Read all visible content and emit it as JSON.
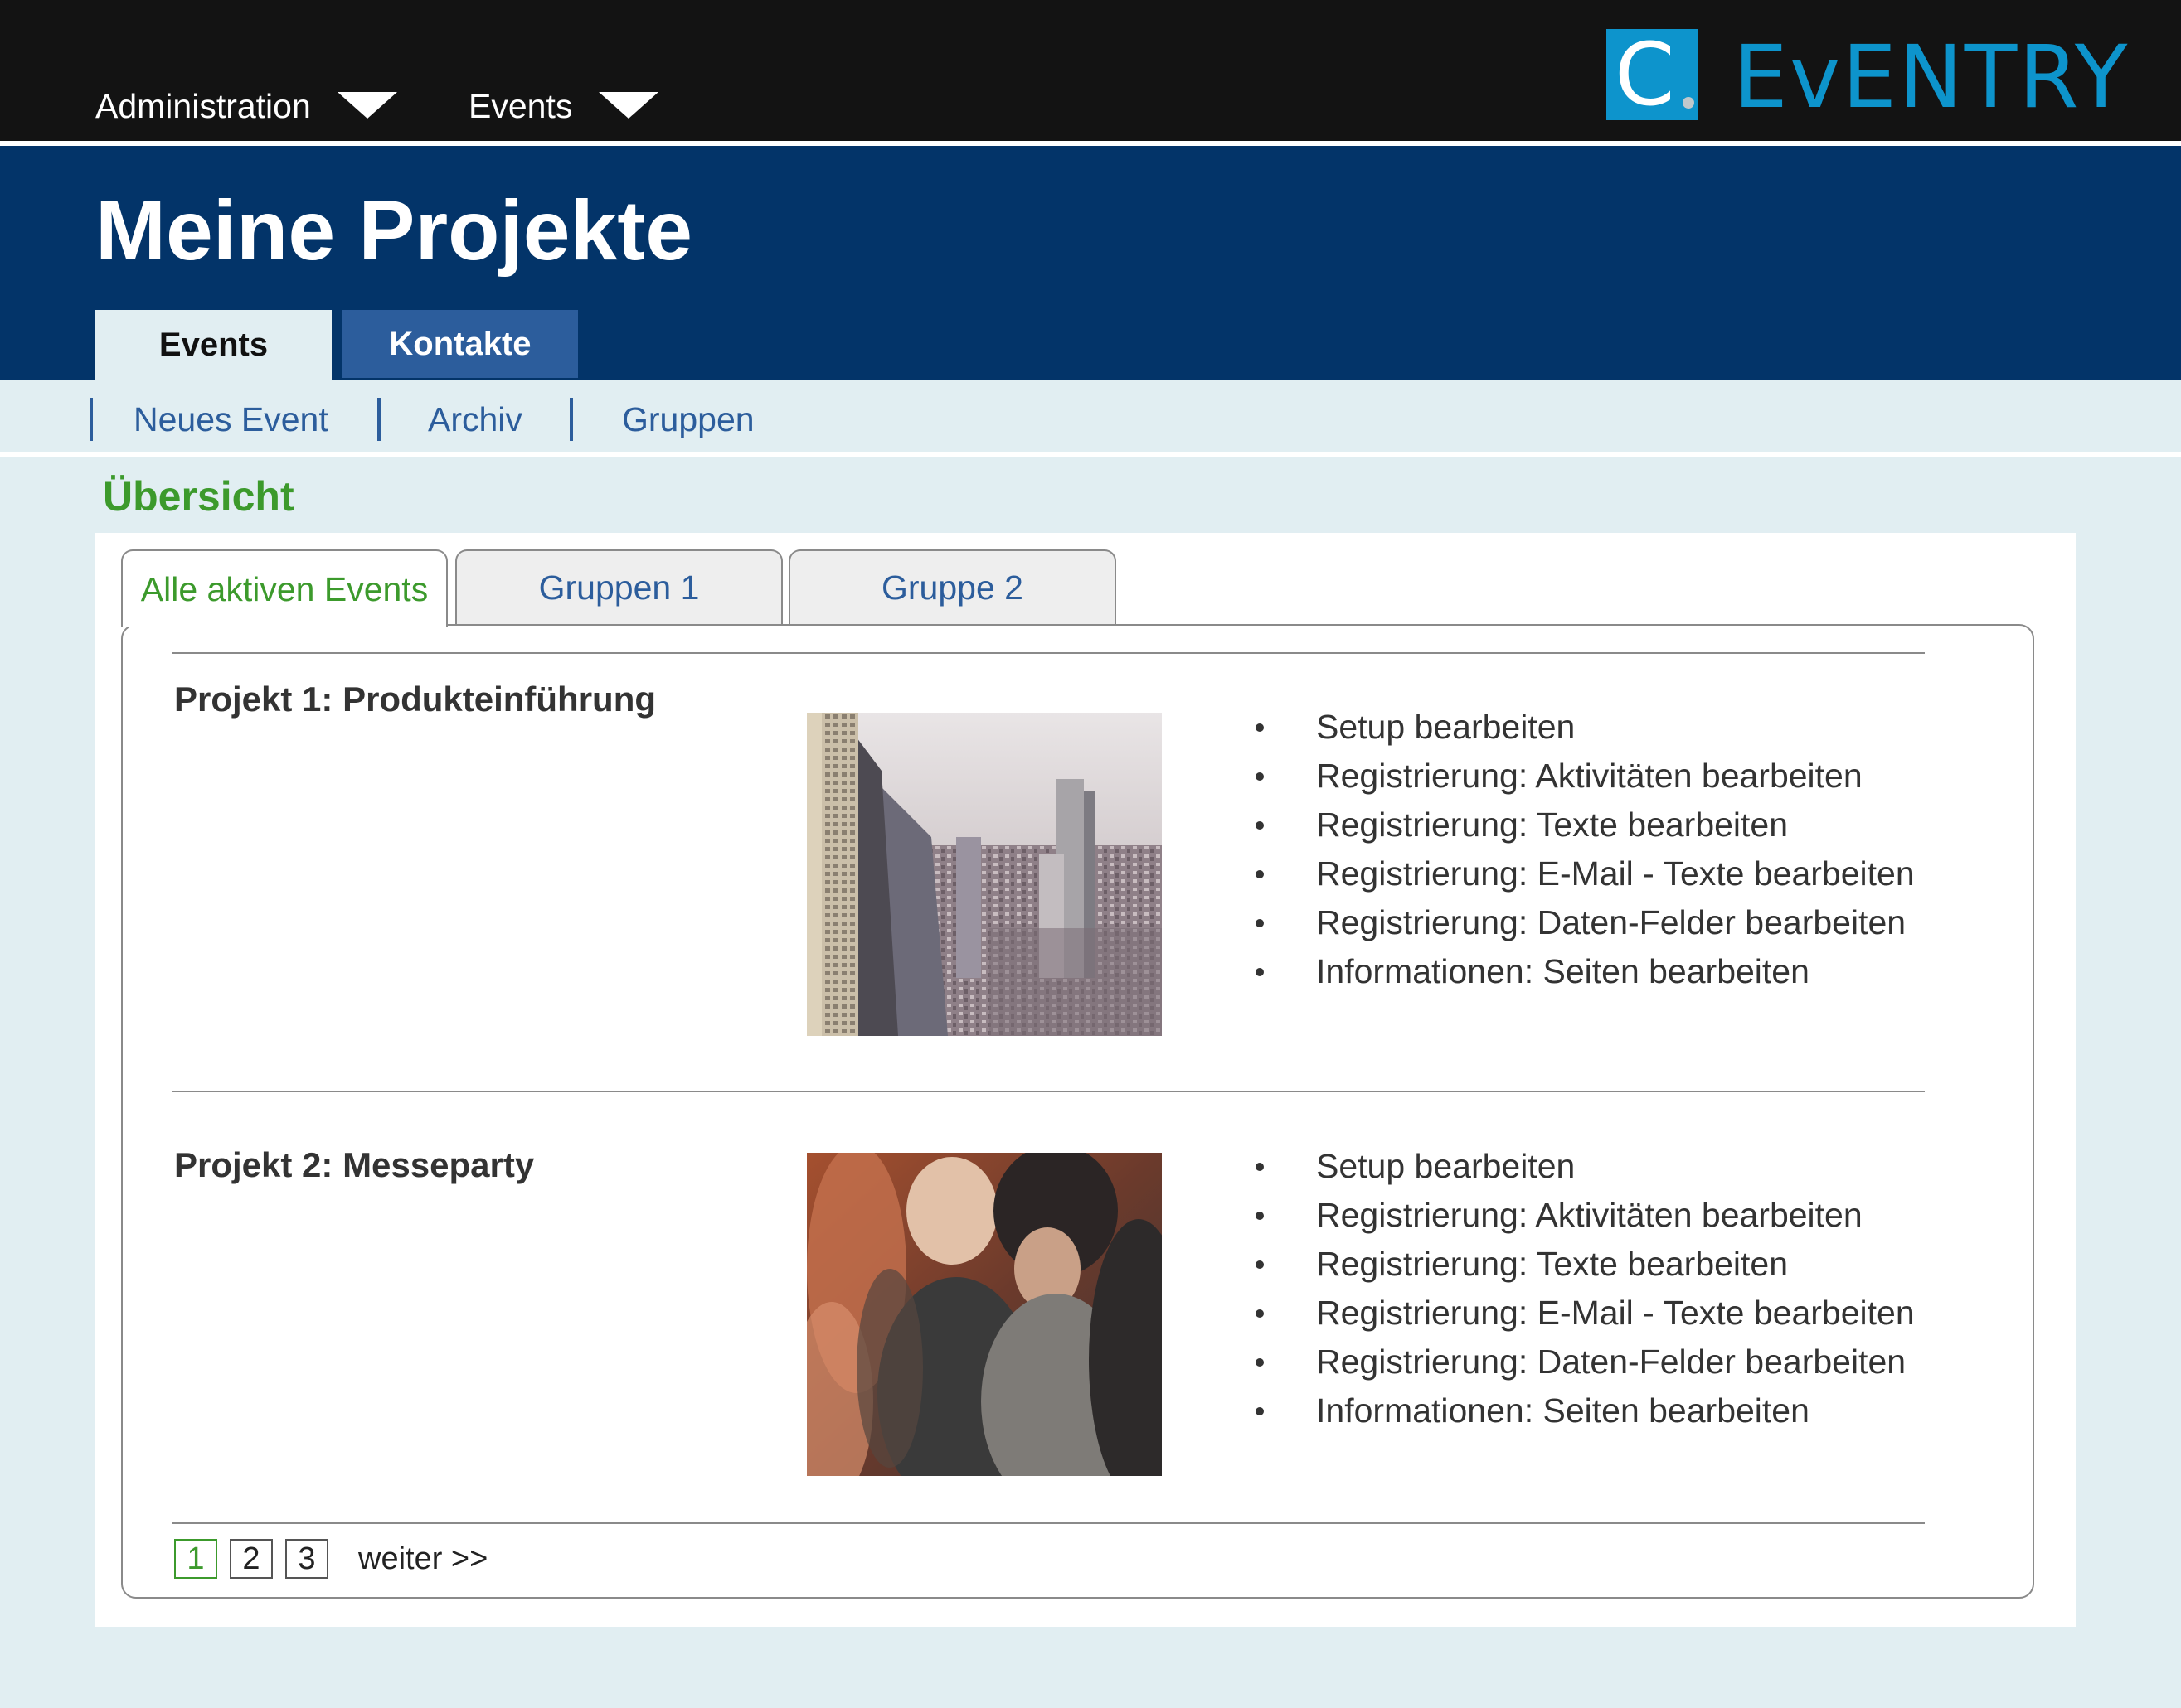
{
  "topnav": {
    "items": [
      {
        "label": "Administration",
        "icon": "chevron-down-icon"
      },
      {
        "label": "Events",
        "icon": "chevron-down-icon"
      }
    ]
  },
  "logo": {
    "letter": "C",
    "name": "EvENTRY",
    "color": "#0d94cc"
  },
  "header": {
    "title": "Meine Projekte",
    "background": "#033469"
  },
  "main_tabs": [
    {
      "label": "Events",
      "active": true
    },
    {
      "label": "Kontakte",
      "active": false
    }
  ],
  "subnav": {
    "items": [
      "Neues Event",
      "Archiv",
      "Gruppen"
    ]
  },
  "section": {
    "title": "Übersicht",
    "accent": "#3c9a2c"
  },
  "content_tabs": [
    {
      "label": "Alle aktiven Events",
      "active": true
    },
    {
      "label": "Gruppen 1",
      "active": false
    },
    {
      "label": "Gruppe 2",
      "active": false
    }
  ],
  "projects": [
    {
      "title": "Projekt 1: Produkteinführung",
      "image": "city-skyline-photo",
      "actions": [
        "Setup bearbeiten",
        "Registrierung: Aktivitäten bearbeiten",
        "Registrierung: Texte bearbeiten",
        "Registrierung: E-Mail - Texte bearbeiten",
        "Registrierung: Daten-Felder bearbeiten",
        "Informationen: Seiten bearbeiten"
      ]
    },
    {
      "title": "Projekt 2: Messeparty",
      "image": "crowd-photo",
      "actions": [
        "Setup bearbeiten",
        "Registrierung: Aktivitäten bearbeiten",
        "Registrierung: Texte bearbeiten",
        "Registrierung: E-Mail - Texte bearbeiten",
        "Registrierung: Daten-Felder bearbeiten",
        "Informationen: Seiten bearbeiten"
      ]
    }
  ],
  "pagination": {
    "pages": [
      "1",
      "2",
      "3"
    ],
    "current": "1",
    "next_label": "weiter >>"
  }
}
